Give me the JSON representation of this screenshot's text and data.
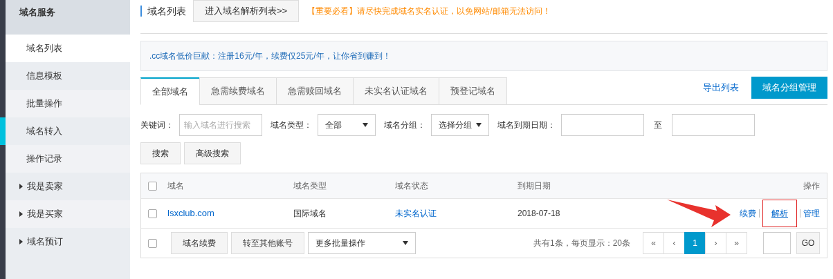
{
  "sidebar": {
    "title": "域名服务",
    "items": [
      {
        "label": "域名列表",
        "kind": "link",
        "selected": true,
        "marked": false
      },
      {
        "label": "信息模板",
        "kind": "link",
        "selected": false,
        "marked": false
      },
      {
        "label": "批量操作",
        "kind": "link",
        "selected": false,
        "marked": false
      },
      {
        "label": "域名转入",
        "kind": "link",
        "selected": false,
        "marked": true
      },
      {
        "label": "操作记录",
        "kind": "link",
        "selected": false,
        "marked": false
      },
      {
        "label": "我是卖家",
        "kind": "group",
        "selected": false,
        "marked": false
      },
      {
        "label": "我是买家",
        "kind": "group",
        "selected": false,
        "marked": false
      },
      {
        "label": "域名预订",
        "kind": "group",
        "selected": false,
        "marked": false
      }
    ]
  },
  "header": {
    "title": "域名列表",
    "button": "进入域名解析列表>>",
    "notice": "【重要必看】请尽快完成域名实名认证，以免网站/邮箱无法访问！"
  },
  "promo": ".cc域名低价巨献：注册16元/年，续费仅25元/年，让你省到赚到！",
  "tabs": [
    {
      "label": "全部域名",
      "selected": true
    },
    {
      "label": "急需续费域名",
      "selected": false
    },
    {
      "label": "急需赎回域名",
      "selected": false
    },
    {
      "label": "未实名认证域名",
      "selected": false
    },
    {
      "label": "预登记域名",
      "selected": false
    }
  ],
  "export_link": "导出列表",
  "group_button": "域名分组管理",
  "filters": {
    "keyword_label": "关键词：",
    "keyword_placeholder": "输入域名进行搜索",
    "type_label": "域名类型：",
    "type_value": "全部",
    "group_label": "域名分组：",
    "group_value": "选择分组",
    "date_label": "域名到期日期：",
    "date_sep": "至",
    "search_button": "搜索",
    "advanced_button": "高级搜索"
  },
  "table": {
    "columns": [
      "域名",
      "域名类型",
      "域名状态",
      "到期日期",
      "操作"
    ],
    "rows": [
      {
        "checked": false,
        "domain": "lsxclub.com",
        "type": "国际域名",
        "status": "未实名认证",
        "expiry": "2018-07-18",
        "actions": [
          {
            "label": "续费",
            "highlighted": false
          },
          {
            "label": "解析",
            "highlighted": true
          },
          {
            "label": "管理",
            "highlighted": false
          }
        ]
      }
    ],
    "header_checked": false
  },
  "footer": {
    "checked": false,
    "buttons": [
      "域名续费",
      "转至其他账号"
    ],
    "batch_select": "更多批量操作",
    "summary": "共有1条，每页显示：20条",
    "pages": [
      {
        "label": "«",
        "selected": false
      },
      {
        "label": "‹",
        "selected": false
      },
      {
        "label": "1",
        "selected": true
      },
      {
        "label": "›",
        "selected": false
      },
      {
        "label": "»",
        "selected": false
      }
    ],
    "go": "GO"
  }
}
